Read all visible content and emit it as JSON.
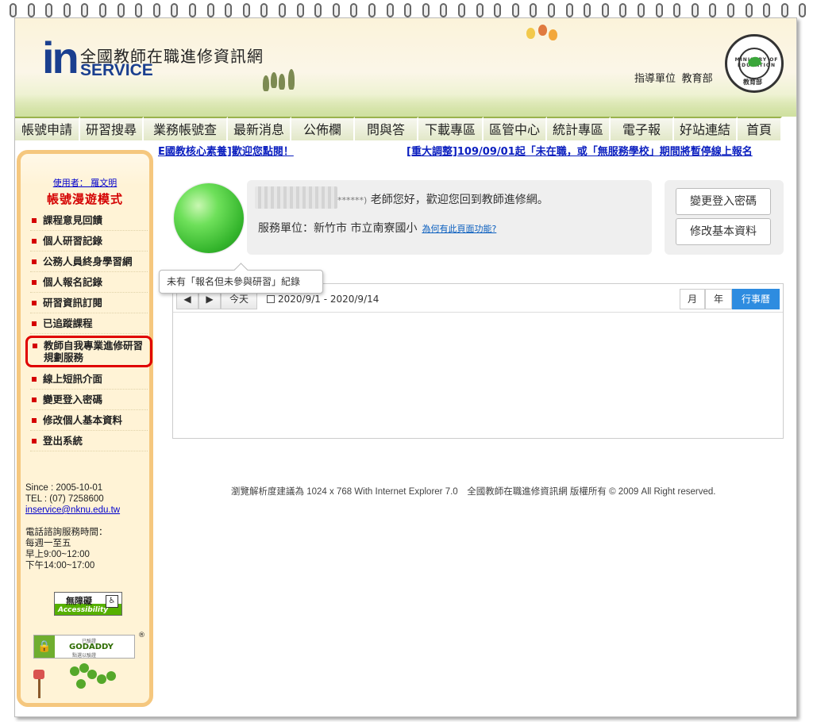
{
  "header": {
    "logo_in": "in",
    "site_title": "全國教師在職進修資訊網",
    "logo_service": "SERVICE",
    "guide_label": "指導單位",
    "guide_org": "教育部",
    "seal_ring_text": "MINISTRY OF EDUCATION",
    "seal_inner_text": "教育部"
  },
  "nav": {
    "items": [
      {
        "label": "帳號申請",
        "width": 82
      },
      {
        "label": "研習搜尋",
        "width": 80
      },
      {
        "label": "業務帳號查",
        "width": 106
      },
      {
        "label": "最新消息",
        "width": 80
      },
      {
        "label": "公佈欄",
        "width": 80
      },
      {
        "label": "問與答",
        "width": 80
      },
      {
        "label": "下載專區",
        "width": 82
      },
      {
        "label": "區管中心",
        "width": 80
      },
      {
        "label": "統計專區",
        "width": 80
      },
      {
        "label": "電子報",
        "width": 80
      },
      {
        "label": "好站連結",
        "width": 80
      },
      {
        "label": "首頁",
        "width": 56
      }
    ]
  },
  "marquee": {
    "item1": "E國教核心素養]歡迎您點閱！",
    "item2": "[重大調整]109/09/01起「未在職，或「無服務學校」期間將暫停線上報名"
  },
  "sidebar": {
    "user": "使用者： 羅文明",
    "mode": "帳號漫遊模式",
    "menu": [
      "課程意見回饋",
      "個人研習記錄",
      "公務人員終身學習網",
      "個人報名記錄",
      "研習資訊訂閱",
      "已追蹤課程",
      "教師自我專業進修研習規劃服務",
      "線上短訊介面",
      "變更登入密碼",
      "修改個人基本資料",
      "登出系統"
    ],
    "since": "Since : 2005-10-01",
    "tel": "TEL : (07) 7258600",
    "email": "inservice@nknu.edu.tw",
    "hours_title": "電話諮詢服務時間：",
    "hours_days": "每週一至五",
    "hours_am": "早上9:00~12:00",
    "hours_pm": "下午14:00~17:00",
    "acc_badge_line1": "無障礙",
    "acc_badge_line2": "Accessibility",
    "gd_badge_top": "已驗證",
    "gd_badge_name": "GODADDY",
    "gd_badge_bottom": "點選以驗證",
    "registered_mark": "®"
  },
  "welcome": {
    "masked_suffix": "******)",
    "greeting": " 老師您好，歡迎您回到教師進修網。",
    "unit_label": "服務單位：新竹市 市立南寮國小",
    "why_link": "為何有此頁面功能?"
  },
  "account_buttons": {
    "change_password": "變更登入密碼",
    "edit_profile": "修改基本資料"
  },
  "tooltip": "未有「報名但未參與研習」紀錄",
  "calendar": {
    "prev": "◀",
    "next": "▶",
    "today": "今天",
    "range": "2020/9/1 - 2020/9/14",
    "views": [
      "月",
      "年",
      "行事曆"
    ],
    "active_view": "行事曆"
  },
  "footer": "瀏覽解析度建議為 1024 x 768 With Internet Explorer 7.0　全國教師在職進修資訊網 版權所有 © 2009 All Right reserved.",
  "colors": {
    "brand_blue": "#1a3f8f",
    "alert_red": "#d40000",
    "link_blue": "#0b1fbf",
    "active_view_blue": "#2e8ce0",
    "nav_top_border": "#9ab24d",
    "sidebar_bg": "#fff3d6"
  }
}
